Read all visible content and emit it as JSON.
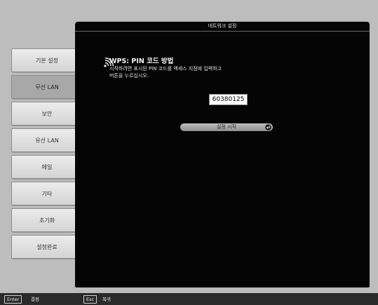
{
  "sidebar": {
    "items": [
      {
        "label": "기본 설정"
      },
      {
        "label": "무선 LAN"
      },
      {
        "label": "보안"
      },
      {
        "label": "유선 LAN"
      },
      {
        "label": "메일"
      },
      {
        "label": "기타"
      },
      {
        "label": "초기화"
      },
      {
        "label": "설정완료"
      }
    ],
    "active_index": 1
  },
  "panel": {
    "title": "네트워크 설정",
    "wps_title": "WPS: PIN 코드 방법",
    "instruction_line1": "시작하려면 표시된 PIN 코드를 액세스 지점에 입력하고",
    "instruction_line2": "버튼을 누르십시오.",
    "pin_code": "60380125",
    "start_button_label": "설정 시작"
  },
  "footer": {
    "enter_key": "Enter",
    "enter_label": "결정",
    "esc_key": "Esc",
    "esc_label": "복귀"
  },
  "colors": {
    "background": "#bdbdbd",
    "panel": "#050505",
    "bottom_bar": "#2a2a2a"
  },
  "icons": {
    "wps": "wifi-signal-icon",
    "start": "enter-return-icon"
  }
}
